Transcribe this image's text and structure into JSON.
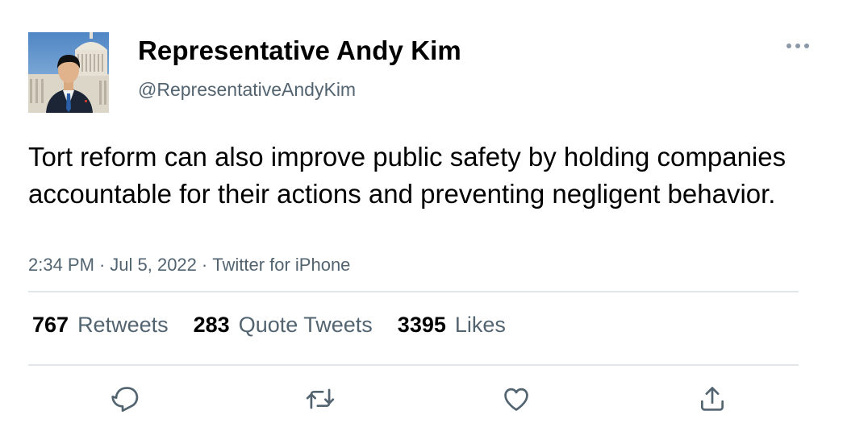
{
  "author": {
    "display_name": "Representative Andy Kim",
    "handle": "@RepresentativeAndyKim",
    "avatar_icon": "profile-photo-capitol"
  },
  "tweet": {
    "text": "Tort reform can also improve public safety by holding companies accountable for their actions and preventing negligent behavior.",
    "time": "2:34 PM",
    "date": "Jul 5, 2022",
    "source": "Twitter for iPhone",
    "separator": "·"
  },
  "stats": {
    "retweets_count": "767",
    "retweets_label": "Retweets",
    "quotes_count": "283",
    "quotes_label": "Quote Tweets",
    "likes_count": "3395",
    "likes_label": "Likes"
  },
  "actions": [
    {
      "icon": "reply-icon"
    },
    {
      "icon": "retweet-icon"
    },
    {
      "icon": "like-icon"
    },
    {
      "icon": "share-icon"
    }
  ],
  "colors": {
    "primary_text": "#000000",
    "secondary_text": "#536471",
    "divider": "#e1e6ea",
    "icon": "#536471"
  }
}
